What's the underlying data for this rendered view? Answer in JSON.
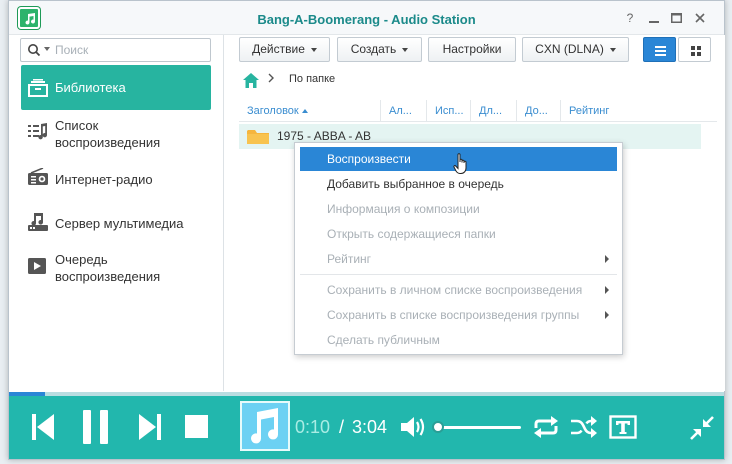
{
  "window": {
    "title": "Bang-A-Boomerang - Audio Station"
  },
  "sidebar": {
    "search_placeholder": "Поиск",
    "items": [
      {
        "label": "Библиотека",
        "icon": "library-icon",
        "active": true
      },
      {
        "label": "Список воспроизведения",
        "icon": "playlist-icon"
      },
      {
        "label": "Интернет-радио",
        "icon": "radio-icon"
      },
      {
        "label": "Сервер мультимедиа",
        "icon": "media-server-icon"
      },
      {
        "label": "Очередь воспроизведения",
        "icon": "play-queue-icon"
      }
    ]
  },
  "toolbar": {
    "action": "Действие",
    "create": "Создать",
    "settings": "Настройки",
    "device": "CXN (DLNA)"
  },
  "breadcrumb": {
    "path": "По папке"
  },
  "grid": {
    "columns": [
      "Заголовок",
      "Ал...",
      "Исп...",
      "Дл...",
      "До...",
      "Рейтинг"
    ],
    "rows": [
      {
        "name": "1975 - ABBA - AB"
      }
    ]
  },
  "context_menu": {
    "items": [
      {
        "label": "Воспроизвести",
        "state": "highlighted"
      },
      {
        "label": "Добавить выбранное в очередь",
        "state": "enabled"
      },
      {
        "label": "Информация о композиции",
        "state": "disabled"
      },
      {
        "label": "Открыть содержащиеся папки",
        "state": "disabled"
      },
      {
        "label": "Рейтинг",
        "state": "disabled",
        "submenu": true
      },
      {
        "label": "Сохранить в личном списке воспроизведения",
        "state": "disabled",
        "submenu": true
      },
      {
        "label": "Сохранить в списке воспроизведения группы",
        "state": "disabled",
        "submenu": true
      },
      {
        "label": "Сделать публичным",
        "state": "disabled"
      }
    ]
  },
  "player": {
    "current_time": "0:10",
    "separator": "/",
    "total_time": "3:04",
    "progress_fraction": 0.05,
    "volume_fraction": 0.0
  },
  "colors": {
    "accent": "#27b4a0",
    "player_bg": "#22b7ad",
    "highlight": "#2a86d6",
    "title": "#1b8a8a"
  }
}
